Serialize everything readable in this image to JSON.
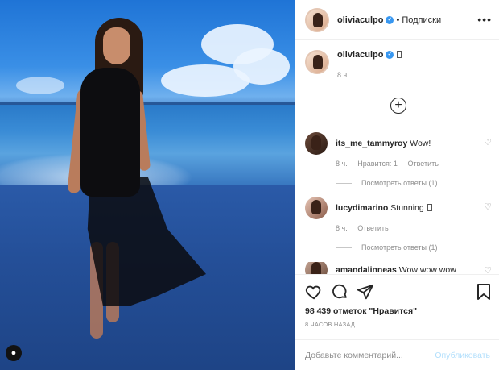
{
  "header": {
    "username": "oliviaculpo",
    "verified_icon": "verified-badge-icon",
    "separator": "•",
    "follow_status": "Подписки",
    "more_icon": "more-options-icon"
  },
  "caption": {
    "username": "oliviaculpo",
    "time": "8 ч."
  },
  "load_more_icon": "plus-circle-icon",
  "comments": [
    {
      "username": "its_me_tammyroy",
      "text": "Wow!",
      "time": "8 ч.",
      "likes": "Нравится: 1",
      "reply": "Ответить",
      "view_replies": "Посмотреть ответы (1)"
    },
    {
      "username": "lucydimarino",
      "text": "Stunning",
      "time": "8 ч.",
      "reply": "Ответить",
      "view_replies": "Посмотреть ответы (1)"
    },
    {
      "username": "amandalinneas",
      "text": "Wow wow wow"
    }
  ],
  "actions": {
    "like_icon": "heart-icon",
    "comment_icon": "comment-icon",
    "share_icon": "paper-plane-icon",
    "save_icon": "bookmark-icon"
  },
  "likes": "98 439 отметок \"Нравится\"",
  "posted": "8 ЧАСОВ НАЗАД",
  "comment_input": {
    "placeholder": "Добавьте комментарий...",
    "publish": "Опубликовать"
  },
  "colors": {
    "accent": "#3897f0",
    "publish_disabled": "#b2dffc",
    "muted": "#8e8e8e"
  }
}
